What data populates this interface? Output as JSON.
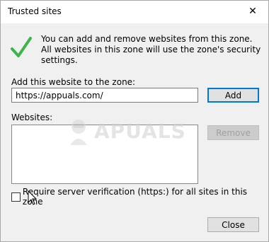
{
  "window": {
    "title": "Trusted sites",
    "close_glyph": "✕"
  },
  "intro": {
    "text": "You can add and remove websites from this zone. All websites in this zone will use the zone's security settings.",
    "icon": "check-icon",
    "icon_color": "#3cb54a"
  },
  "add": {
    "label": "Add this website to the zone:",
    "value": "https://appuals.com/",
    "button": "Add"
  },
  "websites": {
    "label": "Websites:",
    "remove_button": "Remove",
    "items": []
  },
  "watermark": {
    "text": "APUALS",
    "icon": "mascot-icon"
  },
  "verification": {
    "label": "Require server verification (https:) for all sites in this zone",
    "checked": false
  },
  "footer": {
    "close_button": "Close"
  }
}
